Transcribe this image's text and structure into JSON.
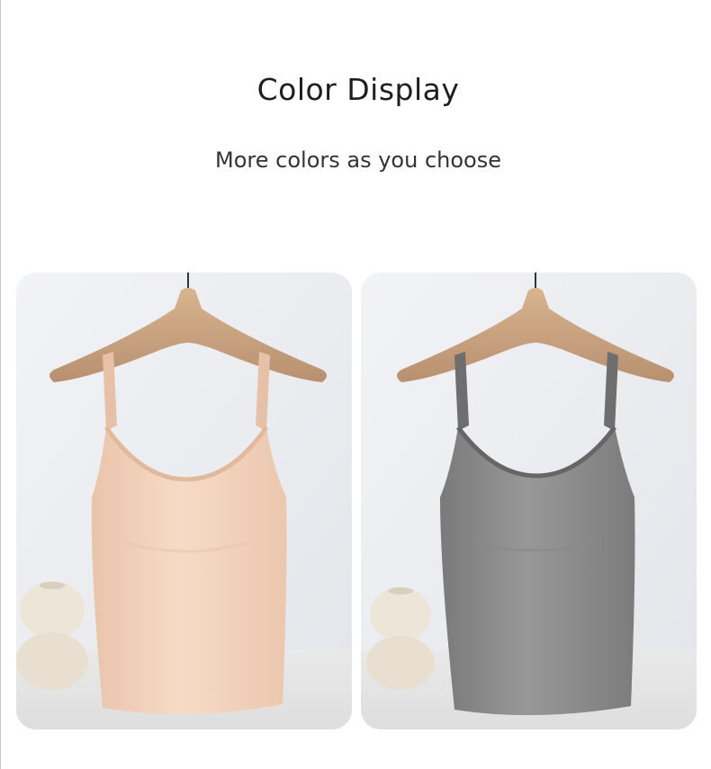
{
  "header": {
    "title": "Color Display",
    "subtitle": "More colors as you choose"
  },
  "products": [
    {
      "variant": "apricot",
      "garment_color": "#f4d3bd",
      "garment_shade": "#e6bfa6"
    },
    {
      "variant": "gray",
      "garment_color": "#8d8d8d",
      "garment_shade": "#747474"
    }
  ],
  "colors": {
    "background": "#ffffff",
    "wall": "#eceef2",
    "floor": "#e3e3e3",
    "hanger_wood": "#c9a47e",
    "vase": "#ece4d6"
  }
}
